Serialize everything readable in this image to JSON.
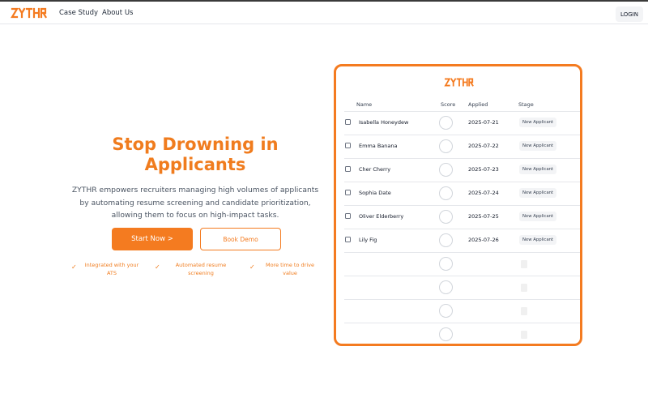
{
  "brand": {
    "name": "ZYTHR",
    "color": "#f47b20"
  },
  "nav": {
    "links": [
      "Case Study",
      "About Us"
    ],
    "login_label": "LOGIN"
  },
  "hero": {
    "title": "Stop Drowning in Applicants",
    "subtitle": "ZYTHR empowers recruiters managing high volumes of applicants by automating resume screening and candidate prioritization, allowing them to focus on high-impact tasks.",
    "primary_cta": "Start Now >",
    "secondary_cta": "Book Demo",
    "features": [
      "Integrated with your ATS",
      "Automated resume screening",
      "More time to drive value"
    ]
  },
  "table": {
    "headers": {
      "name": "Name",
      "score": "Score",
      "applied": "Applied",
      "stage": "Stage"
    },
    "rows": [
      {
        "name": "Isabella Honeydew",
        "applied": "2025-07-21",
        "stage": "New Applicant"
      },
      {
        "name": "Emma Banana",
        "applied": "2025-07-22",
        "stage": "New Applicant"
      },
      {
        "name": "Cher Cherry",
        "applied": "2025-07-23",
        "stage": "New Applicant"
      },
      {
        "name": "Sophia Date",
        "applied": "2025-07-24",
        "stage": "New Applicant"
      },
      {
        "name": "Oliver Elderberry",
        "applied": "2025-07-25",
        "stage": "New Applicant"
      },
      {
        "name": "Lily Fig",
        "applied": "2025-07-26",
        "stage": "New Applicant"
      }
    ],
    "placeholder_row_count": 4
  }
}
